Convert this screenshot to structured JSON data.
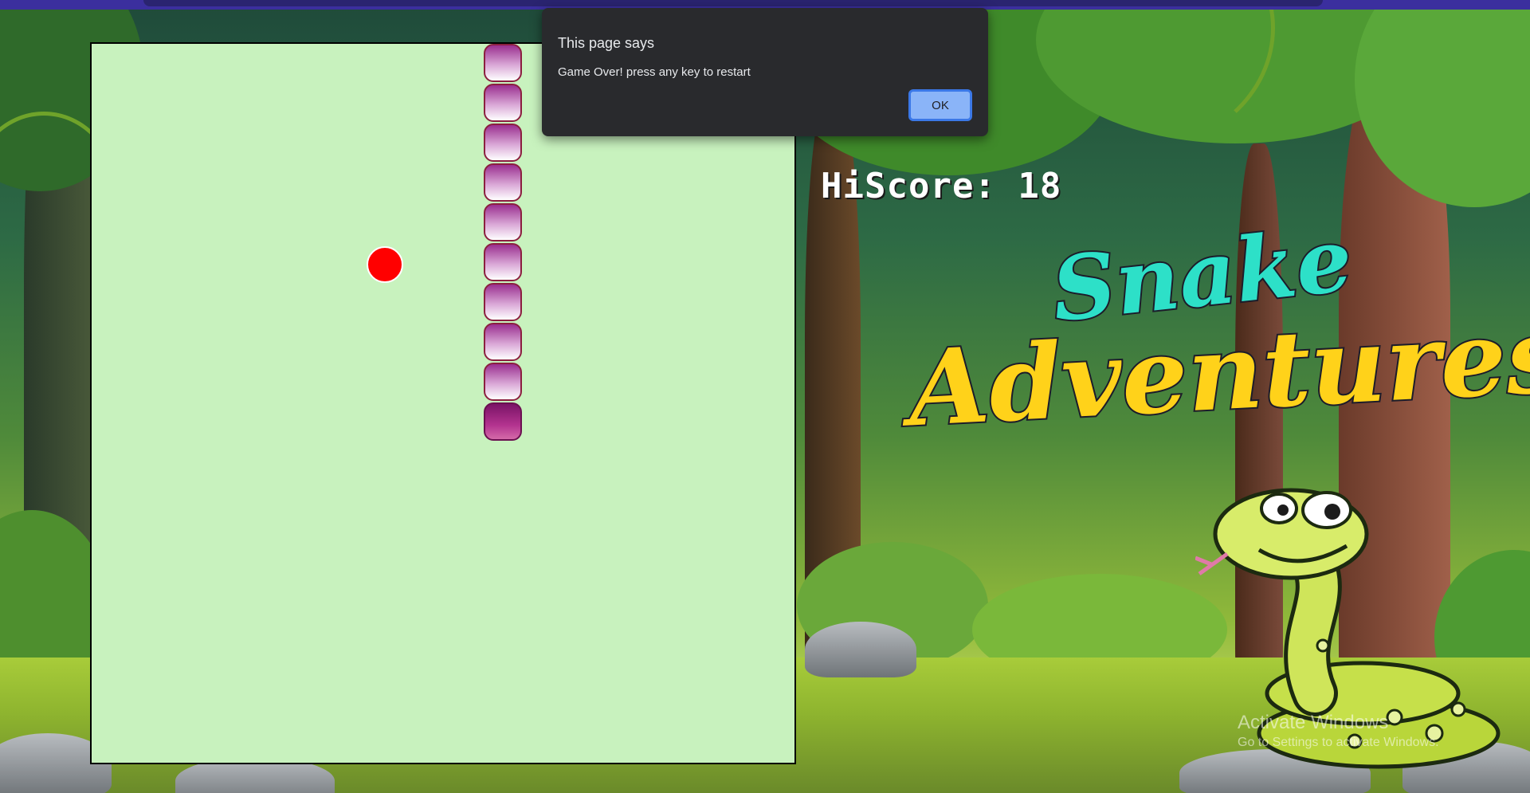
{
  "game": {
    "hiscore_label": "HiScore: 18",
    "board_background": "#c8f2be",
    "snake_color": "#a0308f",
    "food_color": "#ff0000",
    "snake": {
      "segments": 10
    }
  },
  "logo": {
    "line1": "Snake",
    "line2": "Adventures"
  },
  "dialog": {
    "title": "This page says",
    "message": "Game Over! press any key to restart",
    "ok_label": "OK"
  },
  "watermark": {
    "title": "Activate Windows",
    "subtitle": "Go to Settings to activate Windows."
  }
}
